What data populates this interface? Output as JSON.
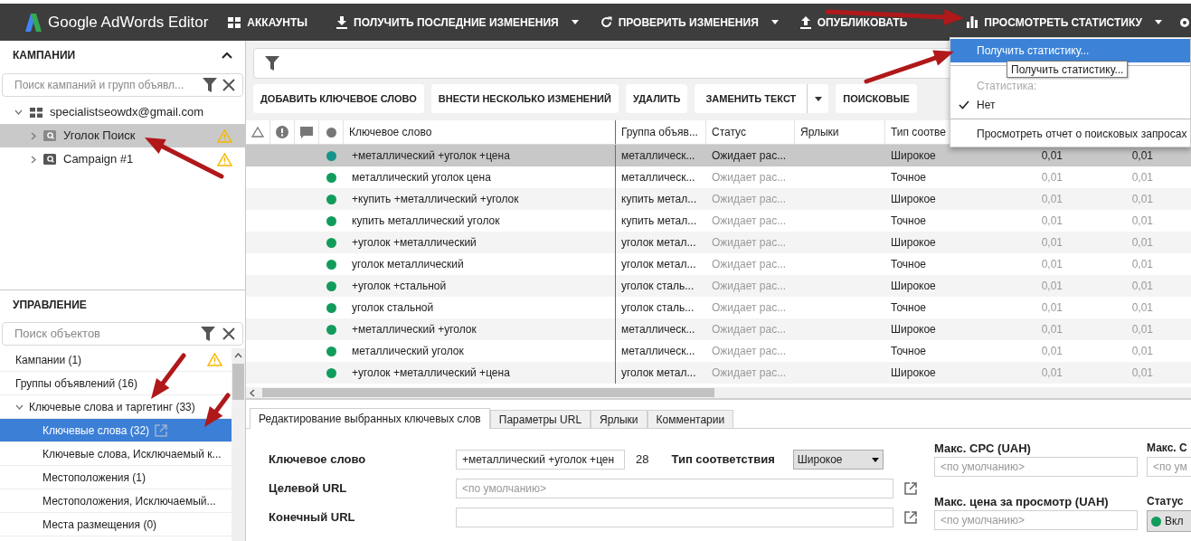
{
  "app": {
    "title": "Google AdWords Editor"
  },
  "toolbar": [
    {
      "label": "АККАУНТЫ",
      "dropdown": false
    },
    {
      "label": "ПОЛУЧИТЬ ПОСЛЕДНИЕ ИЗМЕНЕНИЯ",
      "dropdown": true
    },
    {
      "label": "ПРОВЕРИТЬ ИЗМЕНЕНИЯ",
      "dropdown": true
    },
    {
      "label": "ОПУБЛИКОВАТЬ",
      "dropdown": false
    },
    {
      "label": "ПРОСМОТРЕТЬ СТАТИСТИКУ",
      "dropdown": true
    }
  ],
  "campaigns_panel": {
    "title": "КАМПАНИИ",
    "search": {
      "placeholder": "Поиск кампаний и групп объявл..."
    },
    "tree": [
      {
        "label": "specialistseowdx@gmail.com",
        "expanded": true,
        "selected": false,
        "warning": false,
        "children": [
          {
            "label": "Уголок Поиск",
            "expanded": false,
            "selected": true,
            "warning": true
          },
          {
            "label": "Campaign #1",
            "expanded": false,
            "selected": false,
            "warning": true
          }
        ]
      }
    ]
  },
  "manage_panel": {
    "title": "УПРАВЛЕНИЕ",
    "search": {
      "placeholder": "Поиск объектов"
    },
    "items": [
      {
        "label": "Кампании (1)",
        "selected": false,
        "warning": true
      },
      {
        "label": "Группы объявлений (16)",
        "selected": false,
        "warning": false
      },
      {
        "label": "Ключевые слова и таргетинг (33)",
        "selected": false,
        "warning": false,
        "expanded": true,
        "children": [
          {
            "label": "Ключевые слова (32)",
            "selected": true,
            "warning": false
          },
          {
            "label": "Ключевые слова, Исключаемый к...",
            "selected": false,
            "warning": false
          },
          {
            "label": "Местоположения (1)",
            "selected": false,
            "warning": false
          },
          {
            "label": "Местоположения, Исключаемый...",
            "selected": false,
            "warning": false
          },
          {
            "label": "Места размещения (0)",
            "selected": false,
            "warning": false
          }
        ]
      }
    ]
  },
  "actions": [
    {
      "label": "ДОБАВИТЬ КЛЮЧЕВОЕ СЛОВО",
      "split": false
    },
    {
      "label": "ВНЕСТИ НЕСКОЛЬКО ИЗМЕНЕНИЙ",
      "split": false
    },
    {
      "label": "УДАЛИТЬ",
      "split": false
    },
    {
      "label": "ЗАМЕНИТЬ ТЕКСТ",
      "split": true
    },
    {
      "label": "ПОИСКОВЫЕ",
      "split": false
    }
  ],
  "table": {
    "columns": [
      "Ключевое слово",
      "Группа объяв...",
      "Статус",
      "Ярлыки",
      "Тип соотве"
    ],
    "rows": [
      {
        "keyword": "+металлический +уголок +цена",
        "ad_group": "металлическ...",
        "status": "Ожидает рас...",
        "match_type": "Широкое",
        "column_7": "0,01",
        "column_8": "0,01",
        "selected": true
      },
      {
        "keyword": "металлический уголок цена",
        "ad_group": "металлическ...",
        "status": "Ожидает рас...",
        "match_type": "Точное",
        "column_7": "0,01",
        "column_8": "0,01",
        "selected": false
      },
      {
        "keyword": "+купить +металлический +уголок",
        "ad_group": "купить метал...",
        "status": "Ожидает рас...",
        "match_type": "Широкое",
        "column_7": "0,01",
        "column_8": "0,01",
        "selected": false
      },
      {
        "keyword": "купить металлический уголок",
        "ad_group": "купить метал...",
        "status": "Ожидает рас...",
        "match_type": "Точное",
        "column_7": "0,01",
        "column_8": "0,01",
        "selected": false
      },
      {
        "keyword": "+уголок +металлический",
        "ad_group": "уголок метал...",
        "status": "Ожидает рас...",
        "match_type": "Широкое",
        "column_7": "0,01",
        "column_8": "0,01",
        "selected": false
      },
      {
        "keyword": "уголок металлический",
        "ad_group": "уголок метал...",
        "status": "Ожидает рас...",
        "match_type": "Точное",
        "column_7": "0,01",
        "column_8": "0,01",
        "selected": false
      },
      {
        "keyword": "+уголок +стальной",
        "ad_group": "уголок сталь...",
        "status": "Ожидает рас...",
        "match_type": "Широкое",
        "column_7": "0,01",
        "column_8": "0,01",
        "selected": false
      },
      {
        "keyword": "уголок стальной",
        "ad_group": "уголок сталь...",
        "status": "Ожидает рас...",
        "match_type": "Точное",
        "column_7": "0,01",
        "column_8": "0,01",
        "selected": false
      },
      {
        "keyword": "+металлический +уголок",
        "ad_group": "металлическ...",
        "status": "Ожидает рас...",
        "match_type": "Широкое",
        "column_7": "0,01",
        "column_8": "0,01",
        "selected": false
      },
      {
        "keyword": "металлический уголок",
        "ad_group": "металлическ...",
        "status": "Ожидает рас...",
        "match_type": "Точное",
        "column_7": "0,01",
        "column_8": "0,01",
        "selected": false
      },
      {
        "keyword": "+уголок +металлический +цена",
        "ad_group": "уголок метал...",
        "status": "Ожидает рас...",
        "match_type": "Широкое",
        "column_7": "0,01",
        "column_8": "0,01",
        "selected": false
      }
    ]
  },
  "stats_menu": {
    "items": [
      {
        "kind": "action",
        "label": "Получить статистику...",
        "selected": true
      },
      {
        "kind": "separator"
      },
      {
        "kind": "header",
        "label": "Статистика:"
      },
      {
        "kind": "option",
        "label": "Нет",
        "checked": true
      },
      {
        "kind": "separator"
      },
      {
        "kind": "action",
        "label": "Просмотреть отчет о поисковых запросах",
        "selected": false
      }
    ],
    "tooltip": "Получить статистику..."
  },
  "editor": {
    "tabs": [
      {
        "label": "Редактирование выбранных ключевых слов",
        "selected": true
      },
      {
        "label": "Параметры URL",
        "selected": false
      },
      {
        "label": "Ярлыки",
        "selected": false
      },
      {
        "label": "Комментарии",
        "selected": false
      }
    ],
    "keyword": {
      "label": "Ключевое слово",
      "value": "+металлический +уголок +цен",
      "count": "28"
    },
    "match_type": {
      "label": "Тип соответствия",
      "value": "Широкое"
    },
    "target_url": {
      "label": "Целевой URL",
      "placeholder": "<по умолчанию>"
    },
    "final_url": {
      "label": "Конечный URL"
    },
    "max_cpc": {
      "label": "Макс. CPC (UAH)",
      "placeholder": "<по умолчанию>"
    },
    "max_cpv": {
      "label": "Макс. цена за просмотр (UAH)",
      "placeholder": "<по умолчанию>"
    },
    "column_3": {
      "label": "Макс. С",
      "placeholder": "<по ум"
    },
    "status": {
      "label": "Статус",
      "value": "Вкл",
      "on": true
    }
  }
}
